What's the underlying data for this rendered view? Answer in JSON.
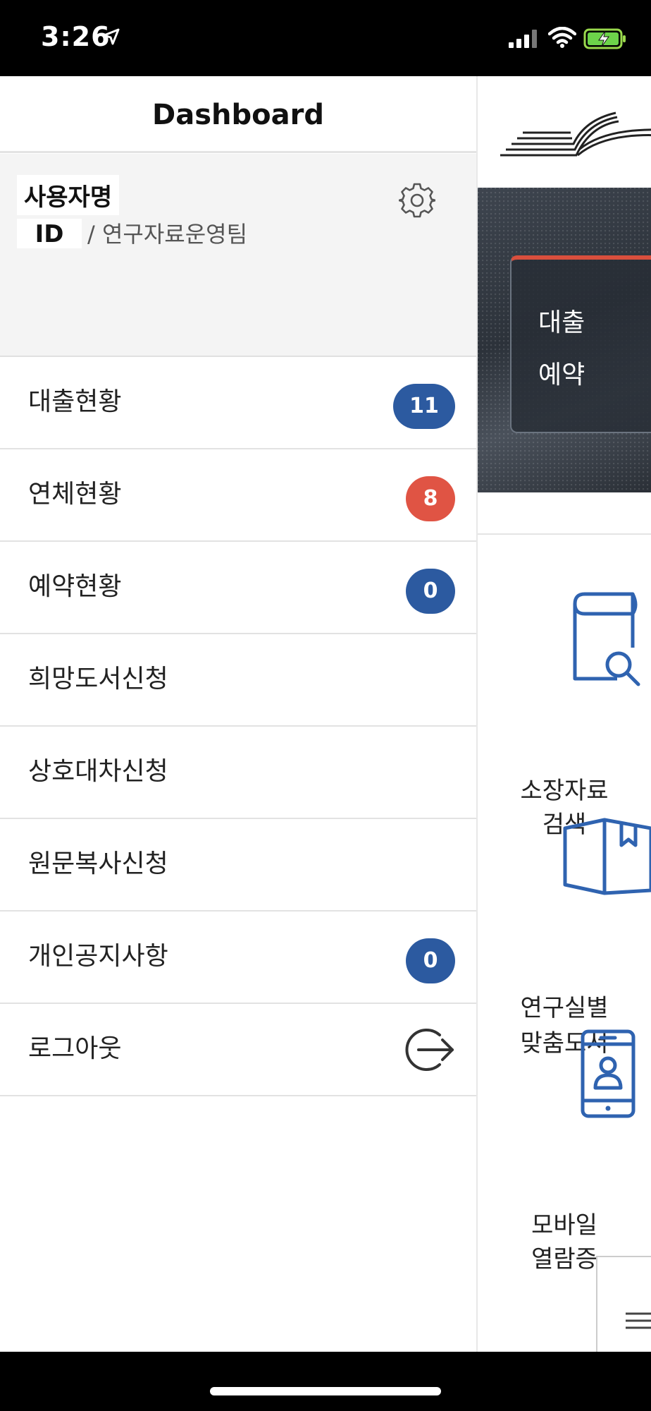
{
  "status_bar": {
    "time": "3:26"
  },
  "drawer": {
    "title": "Dashboard",
    "profile": {
      "user_name": "사용자명",
      "user_id": "ID",
      "team": "/ 연구자료운영팀"
    },
    "menu": [
      {
        "label": "대출현황",
        "badge": "11",
        "badge_color": "#2c5aa0"
      },
      {
        "label": "연체현황",
        "badge": "8",
        "badge_color": "#e05444"
      },
      {
        "label": "예약현황",
        "badge": "0",
        "badge_color": "#2c5aa0"
      },
      {
        "label": "희망도서신청"
      },
      {
        "label": "상호대차신청"
      },
      {
        "label": "원문복사신청"
      },
      {
        "label": "개인공지사항",
        "badge": "0",
        "badge_color": "#2c5aa0"
      },
      {
        "label": "로그아웃",
        "icon": "logout-icon"
      }
    ]
  },
  "background_page": {
    "banner": {
      "items": [
        "대출",
        "예약"
      ]
    },
    "quick_menu": [
      {
        "label_line1": "소장자료",
        "label_line2": "검색",
        "icon": "book-search-icon"
      },
      {
        "label_line1": "연구실별",
        "label_line2": "맞춤도서",
        "icon": "open-book-icon"
      },
      {
        "label_line1": "모바일",
        "label_line2": "열람증",
        "icon": "mobile-id-icon"
      }
    ]
  },
  "colors": {
    "accent_blue": "#2c5aa0",
    "alert_red": "#e05444",
    "icon_blue": "#2f63b0"
  }
}
